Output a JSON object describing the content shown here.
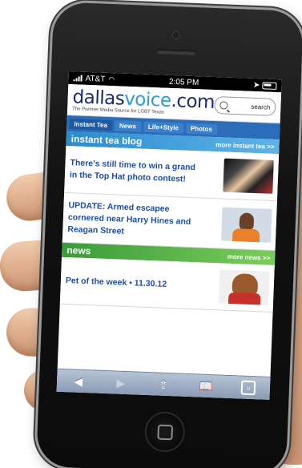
{
  "status_bar": {
    "carrier": "AT&T",
    "time": "2:05 PM"
  },
  "site": {
    "logo_left": "dallas",
    "logo_accent": "voice",
    "logo_right": ".com",
    "tagline": "The Premier Media Source for LGBT Texas"
  },
  "search": {
    "label": "search"
  },
  "nav": {
    "tabs": [
      "Instant Tea",
      "News",
      "Life+Style",
      "Photos"
    ]
  },
  "instant_tea": {
    "title": "instant tea blog",
    "more": "more instant tea >>",
    "articles": [
      "There's still time to win a grand in the Top Hat photo contest!",
      "UPDATE: Armed escapee cornered near Harry Hines and Reagan Street"
    ]
  },
  "news": {
    "title": "news",
    "more": "more news >>",
    "articles": [
      "Pet of the week • 11.30.12"
    ]
  },
  "toolbar": {
    "back": "◀",
    "forward": "▶",
    "share": "⇪",
    "bookmarks": "📖",
    "tabs_count": "8"
  },
  "colors": {
    "nav_blue": "#2b6db8",
    "section_blue": "#2a8ccf",
    "section_green": "#3a9b3a",
    "link_blue": "#1d4fa5"
  }
}
